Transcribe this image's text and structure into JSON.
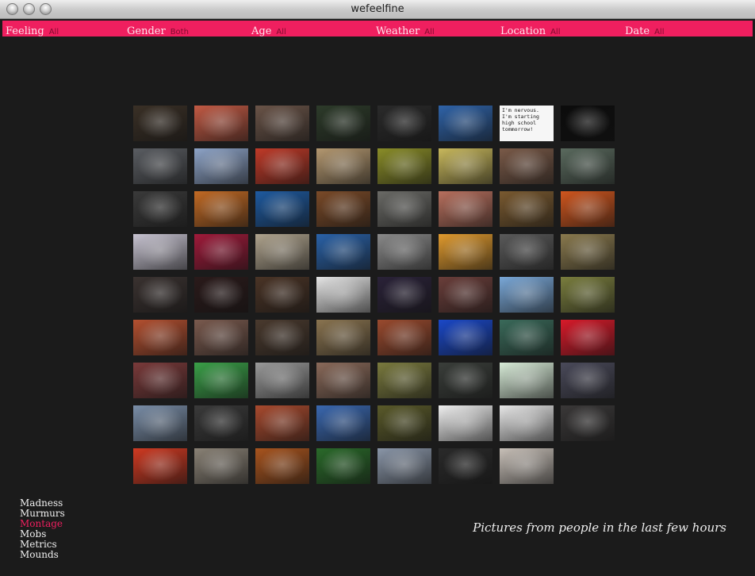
{
  "window": {
    "title": "wefeelfine"
  },
  "filters": [
    {
      "name": "Feeling",
      "value": "All"
    },
    {
      "name": "Gender",
      "value": "Both"
    },
    {
      "name": "Age",
      "value": "All"
    },
    {
      "name": "Weather",
      "value": "All"
    },
    {
      "name": "Location",
      "value": "All"
    },
    {
      "name": "Date",
      "value": "All"
    }
  ],
  "montage": {
    "photo_text": "I'm nervous. I'm starting high school tommorrow!",
    "thumb_colors": [
      [
        "#3a3026",
        "#c25a44",
        "#6a5448",
        "#2d3b2a",
        "#2a2a2a",
        "#2f63a8",
        "#f4f4f4",
        "#0c0c0c"
      ],
      [
        "#5a5d62",
        "#8ea4c8",
        "#c03a28",
        "#b49870",
        "#8a8d28",
        "#c8b85c",
        "#7a5a48",
        "#5a6a5e"
      ],
      [
        "#3a3a3a",
        "#c26a24",
        "#1e5aa0",
        "#7a4a28",
        "#6a6a66",
        "#b8705e",
        "#7a5a30",
        "#d0561e"
      ],
      [
        "#c8c4d2",
        "#a01a3a",
        "#b0a48e",
        "#2a62a8",
        "#8a8a8a",
        "#e09a2e",
        "#5a5a5a",
        "#8a7a4e"
      ],
      [
        "#3a3230",
        "#2a1a1a",
        "#4a3426",
        "#e6e6e6",
        "#2a2238",
        "#6a3e3a",
        "#7aa8d8",
        "#7a7e3e"
      ],
      [
        "#b45030",
        "#7a5a4e",
        "#4a3a2e",
        "#8a7450",
        "#9a4a2e",
        "#1a48c8",
        "#3a6a5a",
        "#d81a2a"
      ],
      [
        "#7a3a3a",
        "#3aa048",
        "#9a9a9a",
        "#8a6a5a",
        "#7a7a3e",
        "#3a3e3a",
        "#d8ecd8",
        "#4a4a5a"
      ],
      [
        "#7a8ea8",
        "#3a3a3a",
        "#a84a2e",
        "#3a68b0",
        "#5a5a2a",
        "#f0f0f0",
        "#e8e8e8",
        "#3a3838"
      ],
      [
        "#d03a22",
        "#8a8276",
        "#a8541e",
        "#2a6a2a",
        "#8a96a8",
        "#2a2a2a",
        "#c8c0b8"
      ]
    ]
  },
  "menu": {
    "items": [
      {
        "label": "Madness"
      },
      {
        "label": "Murmurs"
      },
      {
        "label": "Montage"
      },
      {
        "label": "Mobs"
      },
      {
        "label": "Metrics"
      },
      {
        "label": "Mounds"
      }
    ],
    "active": "Montage"
  },
  "caption": "Pictures from people in the last few hours",
  "colors": {
    "accent": "#ef1f5f",
    "background": "#1b1b1b"
  }
}
